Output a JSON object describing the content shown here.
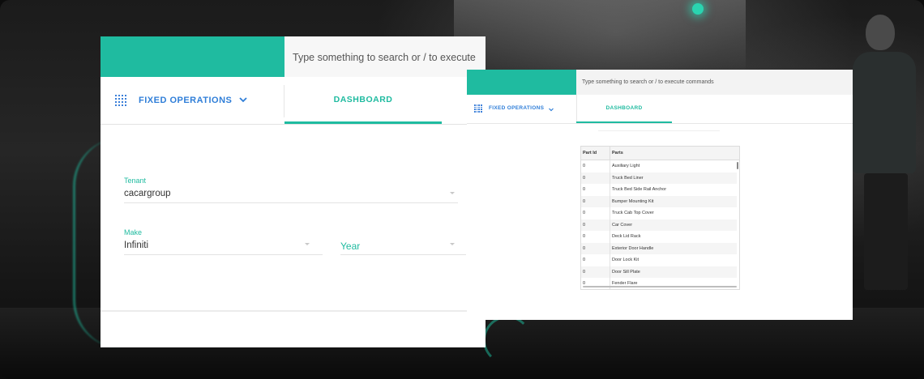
{
  "theme": {
    "accent": "#1fbba0",
    "nav_blue": "#2f7ed8"
  },
  "window_large": {
    "search_placeholder": "Type something to search or / to execute",
    "nav": {
      "menu_icon": "grid-icon",
      "label": "FIXED OPERATIONS",
      "chevron_icon": "chevron-down-icon"
    },
    "tab": {
      "label": "DASHBOARD"
    },
    "form": {
      "tenant": {
        "label": "Tenant",
        "value": "cacargroup"
      },
      "make": {
        "label": "Make",
        "value": "Infiniti"
      },
      "year": {
        "placeholder": "Year"
      }
    }
  },
  "window_small": {
    "search_placeholder": "Type something to search or / to execute commands",
    "nav": {
      "menu_icon": "grid-icon",
      "label": "FIXED OPERATIONS",
      "chevron_icon": "chevron-down-icon"
    },
    "tab": {
      "label": "DASHBOARD"
    },
    "table": {
      "columns": [
        "Part Id",
        "Parts"
      ],
      "rows": [
        {
          "id": "0",
          "part": "Auxiliary Light"
        },
        {
          "id": "0",
          "part": "Truck Bed Liner"
        },
        {
          "id": "0",
          "part": "Truck Bed Side Rail Anchor"
        },
        {
          "id": "0",
          "part": "Bumper Mounting Kit"
        },
        {
          "id": "0",
          "part": "Truck Cab Top Cover"
        },
        {
          "id": "0",
          "part": "Car Cover"
        },
        {
          "id": "0",
          "part": "Deck Lid Rack"
        },
        {
          "id": "0",
          "part": "Exterior Door Handle"
        },
        {
          "id": "0",
          "part": "Door Lock Kit"
        },
        {
          "id": "0",
          "part": "Door Sill Plate"
        },
        {
          "id": "0",
          "part": "Fender Flare"
        }
      ]
    }
  }
}
